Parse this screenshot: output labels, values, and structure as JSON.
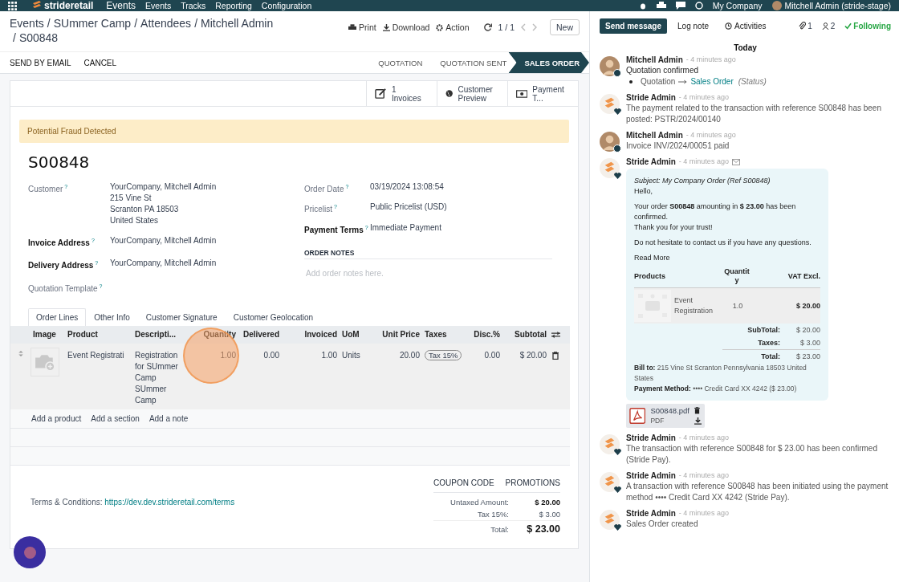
{
  "navbar": {
    "brand": "strideretail",
    "app": "Events",
    "menu": [
      "Events",
      "Tracks",
      "Reporting",
      "Configuration"
    ],
    "company": "My Company",
    "user": "Mitchell Admin (stride-stage)"
  },
  "breadcrumbs": [
    "Events",
    "SUmmer Camp",
    "Attendees",
    "Mitchell Admin",
    "S00848"
  ],
  "breadcrumb_separator": "/",
  "toolbar": {
    "actions": [
      "Print",
      "Download",
      "Action"
    ],
    "pager": "1 / 1",
    "new_button": "New"
  },
  "header_buttons": [
    "SEND BY EMAIL",
    "CANCEL"
  ],
  "stages": [
    {
      "label": "QUOTATION",
      "selected": false
    },
    {
      "label": "QUOTATION SENT",
      "selected": false
    },
    {
      "label": "SALES ORDER",
      "selected": true
    }
  ],
  "smart_buttons": [
    {
      "count": "1",
      "label": "Invoices"
    },
    {
      "label": "Customer Preview"
    },
    {
      "label": "Payment T..."
    }
  ],
  "alert": "Potential Fraud Detected",
  "title": "S00848",
  "left_fields": [
    {
      "label": "Customer",
      "tooltip": "?",
      "required": false,
      "lines": [
        "YourCompany, Mitchell Admin",
        "215 Vine St",
        "Scranton PA 18503",
        "United States"
      ]
    },
    {
      "label": "Invoice Address",
      "tooltip": "?",
      "required": true,
      "lines": [
        "YourCompany, Mitchell Admin"
      ]
    },
    {
      "label": "Delivery Address",
      "tooltip": "?",
      "required": true,
      "lines": [
        "YourCompany, Mitchell Admin"
      ]
    },
    {
      "label": "Quotation Template",
      "tooltip": "?",
      "required": false
    }
  ],
  "right_fields": [
    {
      "label": "Order Date",
      "tooltip": "?",
      "required": false,
      "lines": [
        "03/19/2024 13:08:54"
      ]
    },
    {
      "label": "Pricelist",
      "tooltip": "?",
      "required": false,
      "lines": [
        "Public Pricelist (USD)"
      ]
    },
    {
      "label": "Payment Terms",
      "tooltip": "?",
      "required": true,
      "lines": [
        "Immediate Payment"
      ]
    }
  ],
  "order_notes": {
    "heading": "ORDER NOTES",
    "placeholder": "Add order notes here."
  },
  "tabs": [
    {
      "label": "Order Lines",
      "selected": true
    },
    {
      "label": "Other Info",
      "selected": false
    },
    {
      "label": "Customer Signature",
      "selected": false
    },
    {
      "label": "Customer Geolocation",
      "selected": false
    }
  ],
  "table": {
    "columns": [
      "Image",
      "Product",
      "Descripti...",
      "Quantity",
      "Delivered",
      "Invoiced",
      "UoM",
      "Unit Price",
      "Taxes",
      "Disc.%",
      "Subtotal"
    ],
    "rows": [
      {
        "product": "Event Registrati",
        "description": "Registration for SUmmer Camp\nSUmmer Camp",
        "quantity": "1.00",
        "delivered": "0.00",
        "invoiced": "1.00",
        "uom": "Units",
        "unit_price": "20.00",
        "taxes": "Tax 15%",
        "discount": "0.00",
        "subtotal": "$ 20.00"
      }
    ]
  },
  "add_links": [
    "Add a product",
    "Add a section",
    "Add a note"
  ],
  "footer": {
    "buttons": [
      "COUPON CODE",
      "PROMOTIONS"
    ],
    "terms_label": "Terms & Conditions:",
    "terms_link": "https://dev.dev.strideretail.com/terms",
    "totals": [
      {
        "label": "Untaxed Amount:",
        "value": "$ 20.00",
        "kind": "subtotal"
      },
      {
        "label": "Tax 15%:",
        "value": "$ 3.00",
        "kind": "tax"
      },
      {
        "label": "Total:",
        "value": "$ 23.00",
        "kind": "total"
      }
    ]
  },
  "chatter": {
    "buttons": [
      {
        "label": "Send message",
        "selected": true
      },
      {
        "label": "Log note",
        "selected": false
      },
      {
        "label": "Activities",
        "selected": false
      }
    ],
    "attachments": "1",
    "followers": "2",
    "following": "Following",
    "day": "Today",
    "messages": [
      {
        "author": {
          "name": "Mitchell Admin",
          "kind": "person"
        },
        "time": "- 4 minutes ago",
        "kind": "tracking",
        "body": "Quotation confirmed",
        "tracking": {
          "old": "Quotation",
          "new": "Sales Order",
          "field": "(Status)"
        }
      },
      {
        "author": {
          "name": "Stride Admin",
          "kind": "company"
        },
        "time": "- 4 minutes ago",
        "kind": "note",
        "body": "The payment related to the transaction with reference S00848 has been posted: PSTR/2024/00140"
      },
      {
        "author": {
          "name": "Mitchell Admin",
          "kind": "person"
        },
        "time": "- 4 minutes ago",
        "kind": "note",
        "body": "Invoice INV/2024/00051 paid"
      },
      {
        "author": {
          "name": "Stride Admin",
          "kind": "company"
        },
        "time": "- 4 minutes ago",
        "kind": "email",
        "email": {
          "subject": "Subject: My Company Order (Ref S00848)",
          "greeting": "Hello,",
          "lines": [
            "Your order **S00848** amounting in **$ 23.00** has been confirmed.",
            "Thank you for your trust!"
          ],
          "closing": "Do not hesitate to contact us if you have any questions.",
          "read_more": "Read More",
          "headers": [
            "Products",
            "Quantity",
            "VAT Excl."
          ],
          "rows": [
            {
              "product": "Event Registration",
              "quantity": "1.0",
              "amount": "$ 20.00"
            }
          ],
          "totals": [
            {
              "label": "SubTotal:",
              "value": "$ 20.00"
            },
            {
              "label": "Taxes:",
              "value": "$ 3.00"
            },
            {
              "label": "Total:",
              "value": "$ 23.00"
            }
          ],
          "bill_to": "**Bill to:** 215 Vine St Scranton Pennsylvania 18503 United States",
          "payment_method": "**Payment Method:** •••• Credit Card XX 4242 ($ 23.00)"
        },
        "attachment": {
          "name": "S00848.pdf",
          "type": "PDF"
        }
      },
      {
        "author": {
          "name": "Stride Admin",
          "kind": "company"
        },
        "time": "- 4 minutes ago",
        "kind": "note",
        "body": "The transaction with reference S00848 for $ 23.00 has been confirmed (Stride Pay)."
      },
      {
        "author": {
          "name": "Stride Admin",
          "kind": "company"
        },
        "time": "- 4 minutes ago",
        "kind": "note",
        "body": "A transaction with reference S00848 has been initiated using the payment method •••• Credit Card XX 4242 (Stride Pay)."
      },
      {
        "author": {
          "name": "Stride Admin",
          "kind": "company"
        },
        "time": "- 4 minutes ago",
        "kind": "note",
        "body": "Sales Order created"
      }
    ]
  }
}
